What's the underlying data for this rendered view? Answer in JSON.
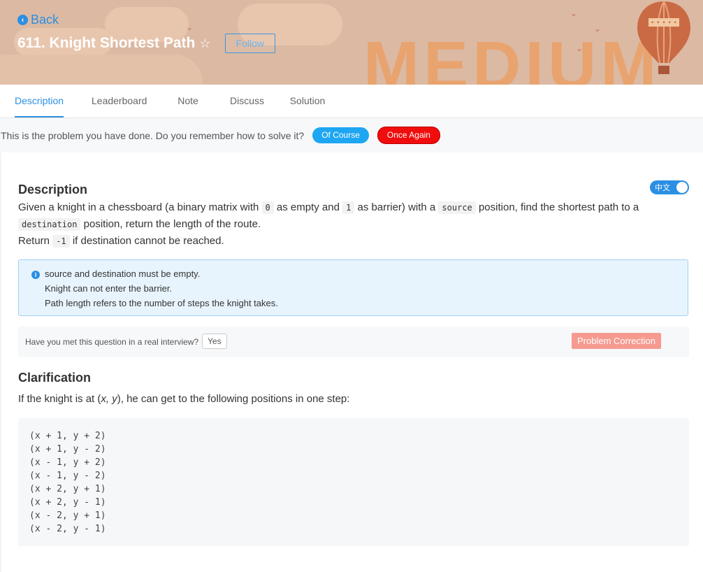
{
  "header": {
    "back_label": "Back",
    "title": "611. Knight Shortest Path",
    "follow_label": "Follow",
    "difficulty": "MEDIUM"
  },
  "tabs": [
    {
      "label": "Description",
      "active": true
    },
    {
      "label": "Leaderboard",
      "active": false
    },
    {
      "label": "Note",
      "active": false
    },
    {
      "label": "Discuss",
      "active": false
    },
    {
      "label": "Solution",
      "active": false
    }
  ],
  "notice": {
    "text": "This is the problem you have done. Do you remember how to solve it?",
    "of_course": "Of Course",
    "once_again": "Once Again"
  },
  "description": {
    "heading": "Description",
    "lang_toggle": "中文",
    "p1_a": "Given a knight in a chessboard (a binary matrix with",
    "code_0": "0",
    "p1_b": "as empty and",
    "code_1": "1",
    "p1_c": "as barrier) with a",
    "code_source": "source",
    "p1_d": "position, find the shortest path to a",
    "code_destination": "destination",
    "p1_e": "position, return the length of the route.",
    "p2_a": "Return",
    "code_neg1": "-1",
    "p2_b": "if destination cannot be reached."
  },
  "info_box": {
    "lines": [
      "source and destination must be empty.",
      "Knight can not enter the barrier.",
      "Path length refers to the number of steps the knight takes."
    ]
  },
  "interview": {
    "question": "Have you met this question in a real interview?",
    "yes_label": "Yes",
    "correction_label": "Problem Correction"
  },
  "clarification": {
    "heading": "Clarification",
    "text_a": "If the knight is at (",
    "text_xy": "x, y",
    "text_b": "), he can get to the following positions in one step:",
    "code_lines": [
      "(x + 1, y + 2)",
      "(x + 1, y - 2)",
      "(x - 1, y + 2)",
      "(x - 1, y - 2)",
      "(x + 2, y + 1)",
      "(x + 2, y - 1)",
      "(x - 2, y + 1)",
      "(x - 2, y - 1)"
    ]
  },
  "colors": {
    "accent": "#2b8fe3",
    "once_again": "#f10d0d",
    "of_course": "#1ea6f2",
    "correction": "#f69a8f"
  }
}
